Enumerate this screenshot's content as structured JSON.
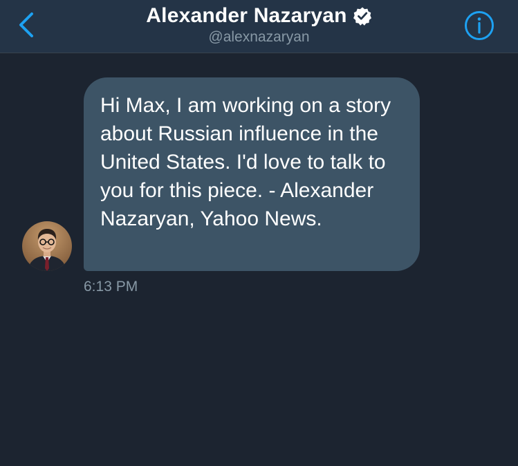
{
  "header": {
    "back_icon": "chevron-left-icon",
    "name": "Alexander Nazaryan",
    "verified_icon": "verified-badge-icon",
    "handle": "@alexnazaryan",
    "info_icon": "info-icon"
  },
  "conversation": {
    "messages": [
      {
        "text": "Hi Max, I am working on a story about Russian influence in the United States. I'd love to talk to you for this piece. - Alexander Nazaryan, Yahoo News.",
        "timestamp": "6:13 PM",
        "sender_avatar": "avatar"
      }
    ]
  },
  "colors": {
    "background": "#1c2430",
    "header_bg": "#243447",
    "bubble_bg": "#3d5466",
    "accent": "#1da1f2",
    "secondary_text": "#8899a6"
  }
}
